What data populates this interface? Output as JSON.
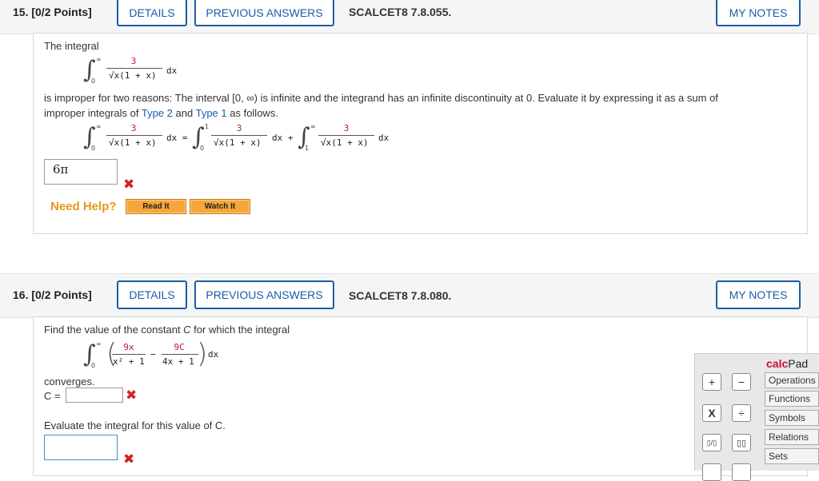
{
  "q15": {
    "number": "15.",
    "points": "[0/2 Points]",
    "details": "DETAILS",
    "previous_answers": "PREVIOUS ANSWERS",
    "code": "SCALCET8 7.8.055.",
    "my_notes": "MY NOTES",
    "intro": "The integral",
    "lower": "0",
    "upper": "∞",
    "numerator": "3",
    "denominator": "√x(1 + x)",
    "dx": "dx",
    "p1": "is improper for two reasons: The interval [0, ∞) is infinite and the integrand has an infinite discontinuity at 0. Evaluate it by expressing it as a sum of",
    "p2_a": "improper integrals of ",
    "type2": "Type 2",
    "p2_b": " and ",
    "type1": "Type 1",
    "p2_c": " as follows.",
    "eq_dx_eq": "dx =",
    "eq_dx_plus": "dx +",
    "eq_dx_end": "dx",
    "mid_upper": "1",
    "mid_lower": "0",
    "third_lower": "1",
    "answer": "6π",
    "need_help": "Need Help?",
    "read_it": "Read It",
    "watch_it": "Watch It"
  },
  "q16": {
    "number": "16.",
    "points": "[0/2 Points]",
    "details": "DETAILS",
    "previous_answers": "PREVIOUS ANSWERS",
    "code": "SCALCET8 7.8.080.",
    "my_notes": "MY NOTES",
    "intro": "Find the value of the constant C for which the integral",
    "num1": "9x",
    "den1": "x² + 1",
    "minus": "−",
    "num2": "9C",
    "den2": "4x + 1",
    "dx": "dx",
    "lower": "0",
    "upper": "∞",
    "converges": "converges.",
    "c_label": "C =",
    "c_value": "",
    "evaluate": "Evaluate the integral for this value of C.",
    "eval_value": ""
  },
  "calcpad": {
    "title_a": "calc",
    "title_b": "Pad",
    "tabs": [
      "Operations",
      "Functions",
      "Symbols",
      "Relations",
      "Sets"
    ],
    "buttons": [
      "+",
      "−",
      "X",
      "÷",
      "▯/▯",
      "▯▯"
    ]
  }
}
